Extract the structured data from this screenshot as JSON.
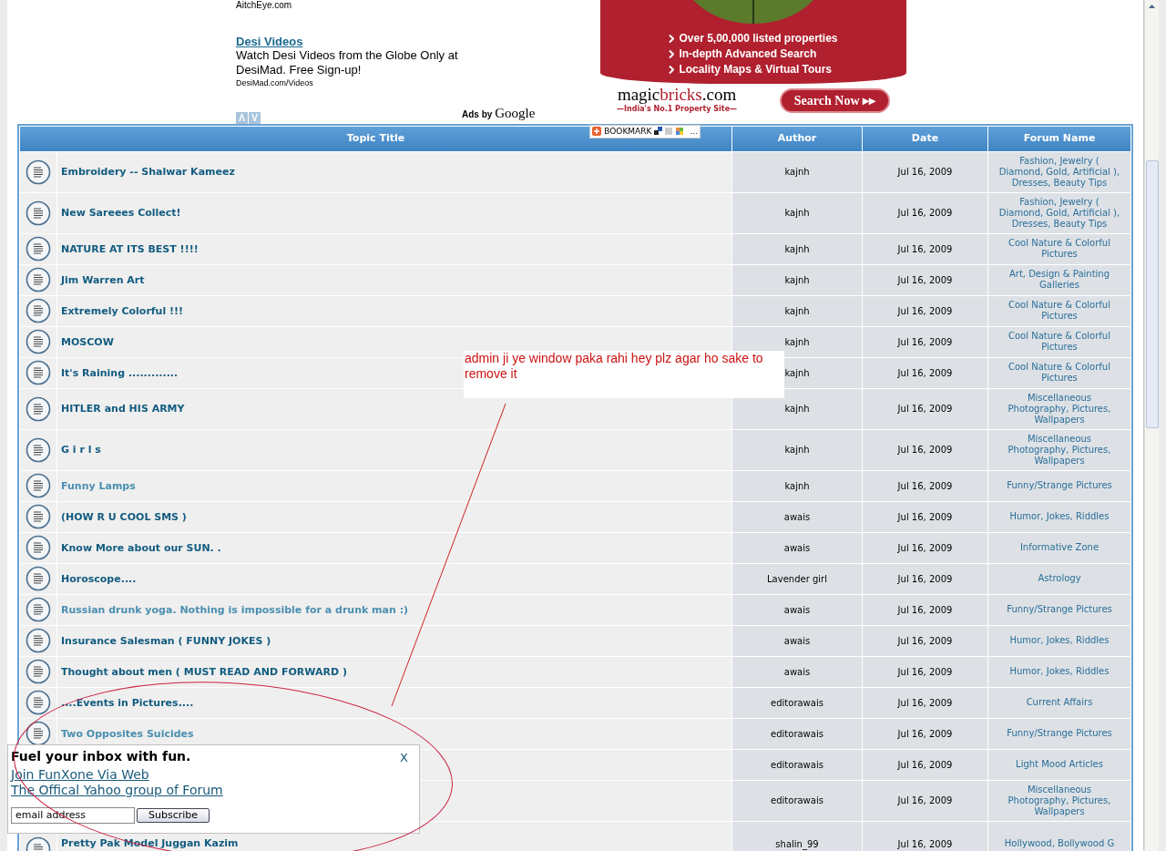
{
  "ads": {
    "previous_url": "AitchEye.com",
    "ad": {
      "title": "Desi Videos",
      "description": "Watch Desi Videos from the Globe Only at DesiMad. Free Sign-up!",
      "url": "DesiMad.com/Videos"
    },
    "nav": [
      "Λ",
      "V"
    ],
    "attribution": "Ads by",
    "attribution_brand": "Google"
  },
  "banner": {
    "bullets": [
      "Over 5,00,000 listed properties",
      "In-depth Advanced Search",
      "Locality Maps & Virtual Tours"
    ],
    "logo_first": "magic",
    "logo_second": "bricks",
    "logo_suffix": ".com",
    "tagline": "—India's No.1 Property Site—",
    "button": "Search Now ▸▸"
  },
  "bookmark": {
    "label": "BOOKMARK",
    "more": "..."
  },
  "table": {
    "columns": [
      "Topic Title",
      "Author",
      "Date",
      "Forum Name"
    ],
    "rows": [
      {
        "title": "Embroidery -- Shalwar Kameez",
        "visited": false,
        "author": "kajnh",
        "date": "Jul 16, 2009",
        "forum": "Fashion, Jewelry ( Diamond, Gold, Artificial ), Dresses, Beauty Tips"
      },
      {
        "title": "New Sareees Collect!",
        "visited": false,
        "author": "kajnh",
        "date": "Jul 16, 2009",
        "forum": "Fashion, Jewelry ( Diamond, Gold, Artificial ), Dresses, Beauty Tips"
      },
      {
        "title": "NATURE AT ITS BEST !!!!",
        "visited": false,
        "author": "kajnh",
        "date": "Jul 16, 2009",
        "forum": "Cool Nature & Colorful Pictures"
      },
      {
        "title": "Jim Warren Art",
        "visited": false,
        "author": "kajnh",
        "date": "Jul 16, 2009",
        "forum": "Art, Design & Painting Galleries"
      },
      {
        "title": "Extremely Colorful !!!",
        "visited": false,
        "author": "kajnh",
        "date": "Jul 16, 2009",
        "forum": "Cool Nature & Colorful Pictures"
      },
      {
        "title": "MOSCOW",
        "visited": false,
        "author": "kajnh",
        "date": "Jul 16, 2009",
        "forum": "Cool Nature & Colorful Pictures"
      },
      {
        "title": "It's Raining .............",
        "visited": false,
        "author": "kajnh",
        "date": "Jul 16, 2009",
        "forum": "Cool Nature & Colorful Pictures"
      },
      {
        "title": "HITLER and HIS ARMY",
        "visited": false,
        "author": "kajnh",
        "date": "Jul 16, 2009",
        "forum": "Miscellaneous Photography, Pictures, Wallpapers"
      },
      {
        "title": "G i r l s",
        "visited": false,
        "author": "kajnh",
        "date": "Jul 16, 2009",
        "forum": "Miscellaneous Photography, Pictures, Wallpapers"
      },
      {
        "title": "Funny Lamps",
        "visited": true,
        "author": "kajnh",
        "date": "Jul 16, 2009",
        "forum": "Funny/Strange Pictures"
      },
      {
        "title": "(HOW R U COOL SMS )",
        "visited": false,
        "author": "awais",
        "date": "Jul 16, 2009",
        "forum": "Humor, Jokes, Riddles"
      },
      {
        "title": "Know More about our SUN. .",
        "visited": false,
        "author": "awais",
        "date": "Jul 16, 2009",
        "forum": "Informative Zone"
      },
      {
        "title": "Horoscope....",
        "visited": false,
        "author": "Lavender girl",
        "date": "Jul 16, 2009",
        "forum": "Astrology"
      },
      {
        "title": "Russian drunk yoga. Nothing is impossible for a drunk man :)",
        "visited": true,
        "author": "awais",
        "date": "Jul 16, 2009",
        "forum": "Funny/Strange Pictures"
      },
      {
        "title": "Insurance Salesman ( FUNNY JOKES )",
        "visited": false,
        "author": "awais",
        "date": "Jul 16, 2009",
        "forum": "Humor, Jokes, Riddles"
      },
      {
        "title": "Thought about men ( MUST READ AND FORWARD )",
        "visited": false,
        "author": "awais",
        "date": "Jul 16, 2009",
        "forum": "Humor, Jokes, Riddles"
      },
      {
        "title": "....Events in Pictures....",
        "visited": false,
        "author": "editorawais",
        "date": "Jul 16, 2009",
        "forum": "Current Affairs"
      },
      {
        "title": "Two Opposites Suicides",
        "visited": true,
        "author": "editorawais",
        "date": "Jul 16, 2009",
        "forum": "Funny/Strange Pictures"
      },
      {
        "author": "editorawais",
        "date": "Jul 16, 2009",
        "forum": "Light Mood Articles"
      },
      {
        "author": "editorawais",
        "date": "Jul 16, 2009",
        "forum": "Miscellaneous Photography, Pictures, Wallpapers"
      },
      {
        "title": "Pretty Pak Model Juggan Kazim",
        "visited": false,
        "author": "shalin_99",
        "date": "Jul 16, 2009",
        "forum": "Hollywood, Bollywood G"
      }
    ]
  },
  "popup": {
    "heading": "Fuel your inbox with fun.",
    "link": "Join FunXone Via Web",
    "sublink": "The Offical Yahoo group of Forum",
    "email_value": "email address",
    "button": "Subscribe",
    "close": "X"
  },
  "annotation": {
    "text": "admin ji ye window paka rahi hey plz agar ho sake to remove it"
  }
}
